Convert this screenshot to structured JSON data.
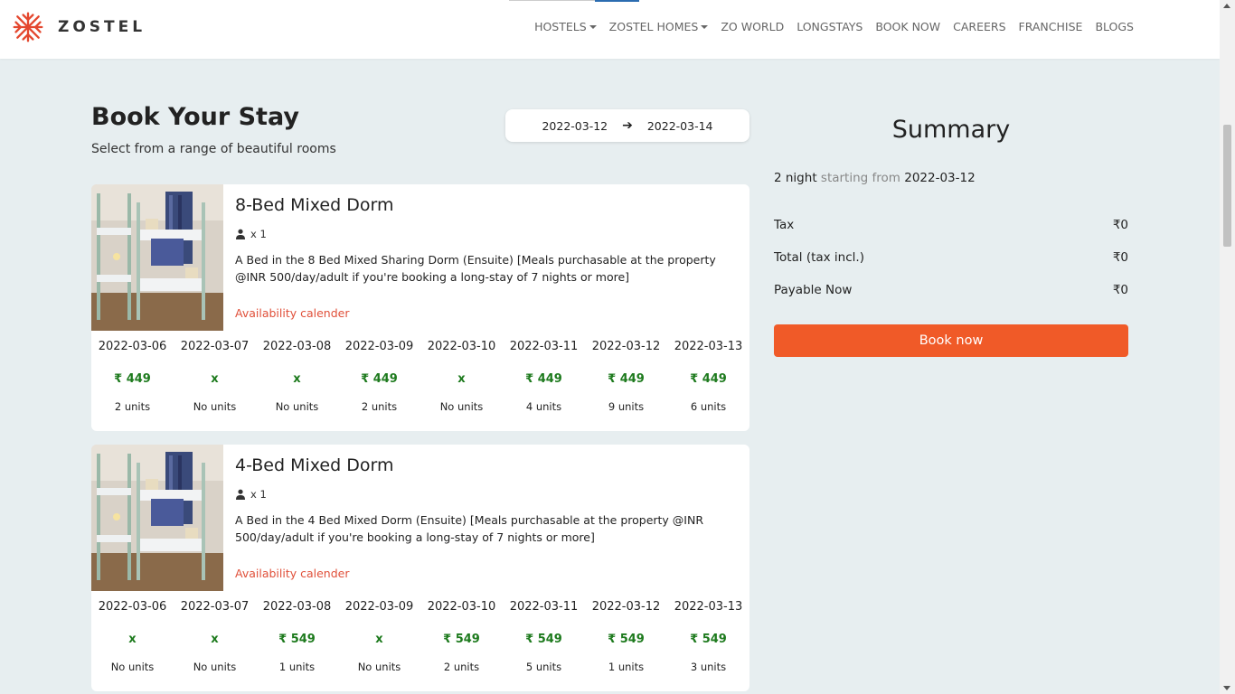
{
  "brand": {
    "name": "ZOSTEL",
    "logo_color": "#e4472e"
  },
  "nav": {
    "items": [
      {
        "label": "HOSTELS",
        "dropdown": true
      },
      {
        "label": "ZOSTEL HOMES",
        "dropdown": true
      },
      {
        "label": "ZO WORLD",
        "dropdown": false
      },
      {
        "label": "LONGSTAYS",
        "dropdown": false
      },
      {
        "label": "BOOK NOW",
        "dropdown": false
      },
      {
        "label": "CAREERS",
        "dropdown": false
      },
      {
        "label": "FRANCHISE",
        "dropdown": false
      },
      {
        "label": "BLOGS",
        "dropdown": false
      }
    ]
  },
  "header": {
    "title": "Book Your Stay",
    "subtitle": "Select from a range of beautiful rooms",
    "check_in": "2022-03-12",
    "check_out": "2022-03-14"
  },
  "rooms": [
    {
      "name": "8-Bed Mixed Dorm",
      "guests": "x 1",
      "description": "A Bed in the 8 Bed Mixed Sharing Dorm (Ensuite) [Meals purchasable at the property @INR 500/day/adult if you're booking a long-stay of 7 nights or more]",
      "availability_label": "Availability calender",
      "calendar": [
        {
          "date": "2022-03-06",
          "price": "₹ 449",
          "units": "2 units"
        },
        {
          "date": "2022-03-07",
          "price": "x",
          "units": "No units"
        },
        {
          "date": "2022-03-08",
          "price": "x",
          "units": "No units"
        },
        {
          "date": "2022-03-09",
          "price": "₹ 449",
          "units": "2 units"
        },
        {
          "date": "2022-03-10",
          "price": "x",
          "units": "No units"
        },
        {
          "date": "2022-03-11",
          "price": "₹ 449",
          "units": "4 units"
        },
        {
          "date": "2022-03-12",
          "price": "₹ 449",
          "units": "9 units"
        },
        {
          "date": "2022-03-13",
          "price": "₹ 449",
          "units": "6 units"
        }
      ]
    },
    {
      "name": "4-Bed Mixed Dorm",
      "guests": "x 1",
      "description": "A Bed in the 4 Bed Mixed Dorm (Ensuite) [Meals purchasable at the property @INR 500/day/adult if you're booking a long-stay of 7 nights or more]",
      "availability_label": "Availability calender",
      "calendar": [
        {
          "date": "2022-03-06",
          "price": "x",
          "units": "No units"
        },
        {
          "date": "2022-03-07",
          "price": "x",
          "units": "No units"
        },
        {
          "date": "2022-03-08",
          "price": "₹ 549",
          "units": "1 units"
        },
        {
          "date": "2022-03-09",
          "price": "x",
          "units": "No units"
        },
        {
          "date": "2022-03-10",
          "price": "₹ 549",
          "units": "2 units"
        },
        {
          "date": "2022-03-11",
          "price": "₹ 549",
          "units": "5 units"
        },
        {
          "date": "2022-03-12",
          "price": "₹ 549",
          "units": "1 units"
        },
        {
          "date": "2022-03-13",
          "price": "₹ 549",
          "units": "3 units"
        }
      ]
    }
  ],
  "summary": {
    "title": "Summary",
    "nights": "2 night",
    "starting_from": "starting from",
    "start_date": "2022-03-12",
    "rows": [
      {
        "label": "Tax",
        "value": "₹0"
      },
      {
        "label": "Total (tax incl.)",
        "value": "₹0"
      },
      {
        "label": "Payable Now",
        "value": "₹0"
      }
    ],
    "book_label": "Book now"
  },
  "colors": {
    "accent": "#f05a28",
    "price_green": "#1d7a1d",
    "link_red": "#e0503a",
    "background": "#e7eef0"
  }
}
